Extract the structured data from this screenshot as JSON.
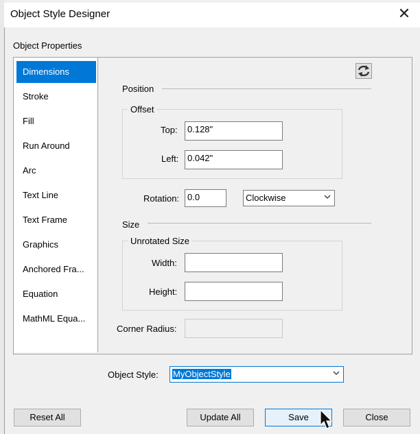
{
  "window": {
    "title": "Object Style Designer",
    "close_glyph": "✕"
  },
  "object_properties_label": "Object Properties",
  "sidebar": {
    "items": [
      {
        "label": "Dimensions",
        "selected": true
      },
      {
        "label": "Stroke"
      },
      {
        "label": "Fill"
      },
      {
        "label": "Run Around"
      },
      {
        "label": "Arc"
      },
      {
        "label": "Text Line"
      },
      {
        "label": "Text Frame"
      },
      {
        "label": "Graphics"
      },
      {
        "label": "Anchored Fra..."
      },
      {
        "label": "Equation"
      },
      {
        "label": "MathML Equa..."
      }
    ]
  },
  "position": {
    "heading": "Position",
    "offset": {
      "heading": "Offset",
      "top_label": "Top:",
      "top_value": "0.128\"",
      "left_label": "Left:",
      "left_value": "0.042\""
    },
    "rotation_label": "Rotation:",
    "rotation_value": "0.0",
    "direction_value": "Clockwise"
  },
  "size": {
    "heading": "Size",
    "unrotated": {
      "heading": "Unrotated Size",
      "width_label": "Width:",
      "width_value": "",
      "height_label": "Height:",
      "height_value": ""
    },
    "corner_radius_label": "Corner Radius:",
    "corner_radius_value": ""
  },
  "object_style": {
    "label": "Object Style:",
    "value": "MyObjectStyle"
  },
  "buttons": {
    "reset_all": "Reset All",
    "update_all": "Update All",
    "save": "Save",
    "close": "Close"
  },
  "icons": {
    "refresh": "refresh-icon",
    "cursor": "mouse-pointer-icon"
  },
  "colors": {
    "selection": "#0078d7",
    "dialog_bg": "#f0f0f0"
  }
}
